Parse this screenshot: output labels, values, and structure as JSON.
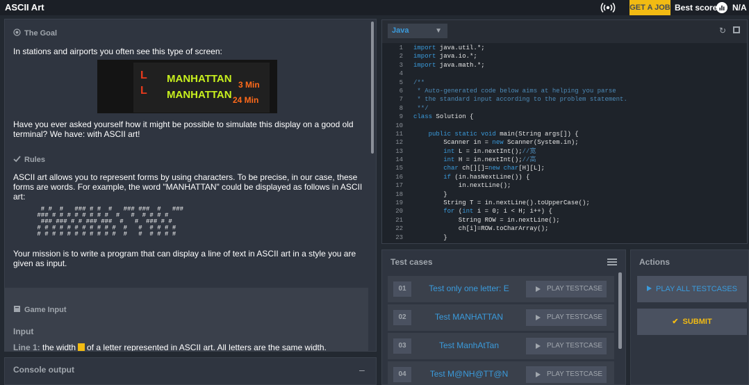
{
  "app": {
    "title": "ASCII Art",
    "get_job_label": "GET A JOB",
    "best_score_label": "Best score",
    "best_score_value": "N/A"
  },
  "goal": {
    "heading": "The Goal",
    "intro": "In stations and airports you often see this type of screen:",
    "question": "Have you ever asked yourself how it might be possible to simulate this display on a good old terminal? We have: with ASCII art!"
  },
  "banner": {
    "rows": [
      {
        "letter": "L",
        "text": "MANHATTAN",
        "time": "3 Min"
      },
      {
        "letter": "L",
        "text": "MANHATTAN",
        "time": "24 Min"
      }
    ]
  },
  "rules": {
    "heading": "Rules",
    "text": "ASCII art allows you to represent forms by using characters. To be precise, in our case, these forms are words. For example, the word \"MANHATTAN\" could be displayed as follows in ASCII art:",
    "ascii_lines": [
      "  # #  #   ### # #  #   ### ###  #   ###",
      " ### # # # # # # # #  #   #  # # # #",
      "  ### ### # # ### ###  #   #  ### # #",
      " # # # # # # # # # # #  #   #  # # # #",
      " # # # # # # # # # # #  #   #  # # # #"
    ],
    "mission": "Your mission is to write a program that can display a line of text in ASCII art in a style you are given as input."
  },
  "game_input": {
    "heading": "Game Input",
    "input_label": "Input",
    "line1_label": "Line 1:",
    "line1_pre": "the width",
    "line1_post": "of a letter represented in ASCII art. All letters are the same width."
  },
  "console": {
    "title": "Console output",
    "minimize": "–"
  },
  "editor": {
    "language": "Java",
    "lines": [
      {
        "n": "1",
        "html": "<span class='kw'>import</span> java.util.*;"
      },
      {
        "n": "2",
        "html": "<span class='kw'>import</span> java.io.*;"
      },
      {
        "n": "3",
        "html": "<span class='kw'>import</span> java.math.*;"
      },
      {
        "n": "4",
        "html": ""
      },
      {
        "n": "5",
        "html": "<span class='cm'>/**</span>"
      },
      {
        "n": "6",
        "html": "<span class='cm'> * Auto-generated code below aims at helping you parse</span>"
      },
      {
        "n": "7",
        "html": "<span class='cm'> * the standard input according to the problem statement.</span>"
      },
      {
        "n": "8",
        "html": "<span class='cm'> **/</span>"
      },
      {
        "n": "9",
        "html": "<span class='kw'>class</span> Solution {"
      },
      {
        "n": "10",
        "html": ""
      },
      {
        "n": "11",
        "html": "    <span class='kw'>public static void</span> main(String args[]) {"
      },
      {
        "n": "12",
        "html": "        Scanner in = <span class='kw'>new</span> Scanner(System.in);"
      },
      {
        "n": "13",
        "html": "        <span class='kw'>int</span> L = in.nextInt();<span class='cm'>//宽</span>"
      },
      {
        "n": "14",
        "html": "        <span class='kw'>int</span> H = in.nextInt();<span class='cm'>//高</span>"
      },
      {
        "n": "15",
        "html": "        <span class='kw'>char</span> ch[][]=<span class='kw'>new char</span>[H][L];"
      },
      {
        "n": "16",
        "html": "        <span class='kw'>if</span> (in.hasNextLine()) {"
      },
      {
        "n": "17",
        "html": "            in.nextLine();"
      },
      {
        "n": "18",
        "html": "        }"
      },
      {
        "n": "19",
        "html": "        String T = in.nextLine().toUpperCase();"
      },
      {
        "n": "20",
        "html": "        <span class='kw'>for</span> (<span class='kw'>int</span> i = 0; i &lt; H; i++) {"
      },
      {
        "n": "21",
        "html": "            String ROW = in.nextLine();"
      },
      {
        "n": "22",
        "html": "            ch[i]=ROW.toCharArray();"
      },
      {
        "n": "23",
        "html": "        }"
      }
    ]
  },
  "testcases": {
    "title": "Test cases",
    "play_label": "PLAY TESTCASE",
    "items": [
      {
        "num": "01",
        "name": "Test only one letter: E"
      },
      {
        "num": "02",
        "name": "Test MANHATTAN"
      },
      {
        "num": "03",
        "name": "Test ManhAtTan"
      },
      {
        "num": "04",
        "name": "Test M@NH@TT@N"
      }
    ]
  },
  "actions": {
    "title": "Actions",
    "play_all_label": "PLAY ALL TESTCASES",
    "submit_label": "SUBMIT"
  }
}
